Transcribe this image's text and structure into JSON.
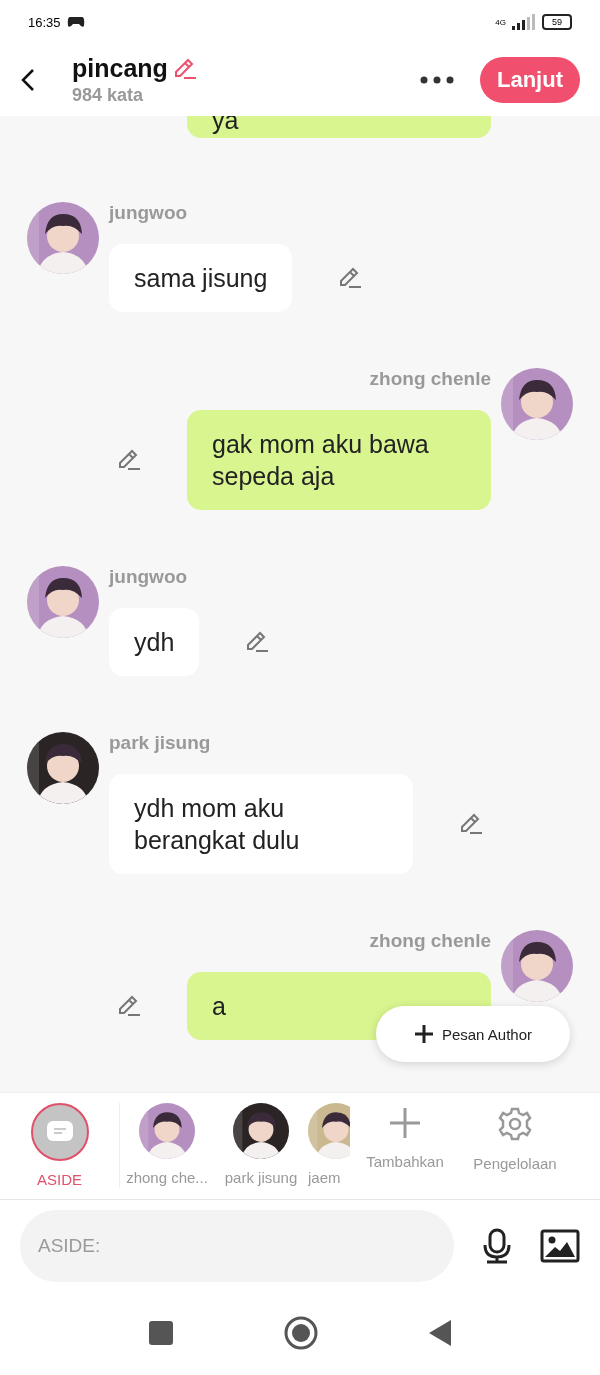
{
  "status_bar": {
    "time": "16:35",
    "network": "4G",
    "battery": "59"
  },
  "header": {
    "title": "pincang",
    "word_count": "984 kata",
    "next_button": "Lanjut"
  },
  "messages": [
    {
      "kind": "outgoing",
      "text": "ya",
      "cut": true
    },
    {
      "kind": "incoming",
      "sender": "jungwoo",
      "text": "sama jisung"
    },
    {
      "kind": "outgoing",
      "sender": "zhong chenle",
      "text": "gak mom aku bawa sepeda aja"
    },
    {
      "kind": "incoming",
      "sender": "jungwoo",
      "text": "ydh"
    },
    {
      "kind": "incoming",
      "sender": "park jisung",
      "text": "ydh mom aku berangkat dulu"
    },
    {
      "kind": "outgoing",
      "sender": "zhong chenle",
      "text": "a"
    }
  ],
  "floating_button": "Pesan Author",
  "characters": [
    {
      "kind": "aside",
      "label": "ASIDE",
      "selected": true
    },
    {
      "kind": "person",
      "label": "zhong che...",
      "selected": false
    },
    {
      "kind": "person",
      "label": "park jisung",
      "selected": false
    },
    {
      "kind": "person",
      "label": "jaem",
      "selected": false,
      "cut": true
    },
    {
      "kind": "add",
      "label": "Tambahkan",
      "selected": false
    },
    {
      "kind": "settings",
      "label": "Pengelolaan",
      "selected": false
    }
  ],
  "composer": {
    "placeholder": "ASIDE:"
  }
}
